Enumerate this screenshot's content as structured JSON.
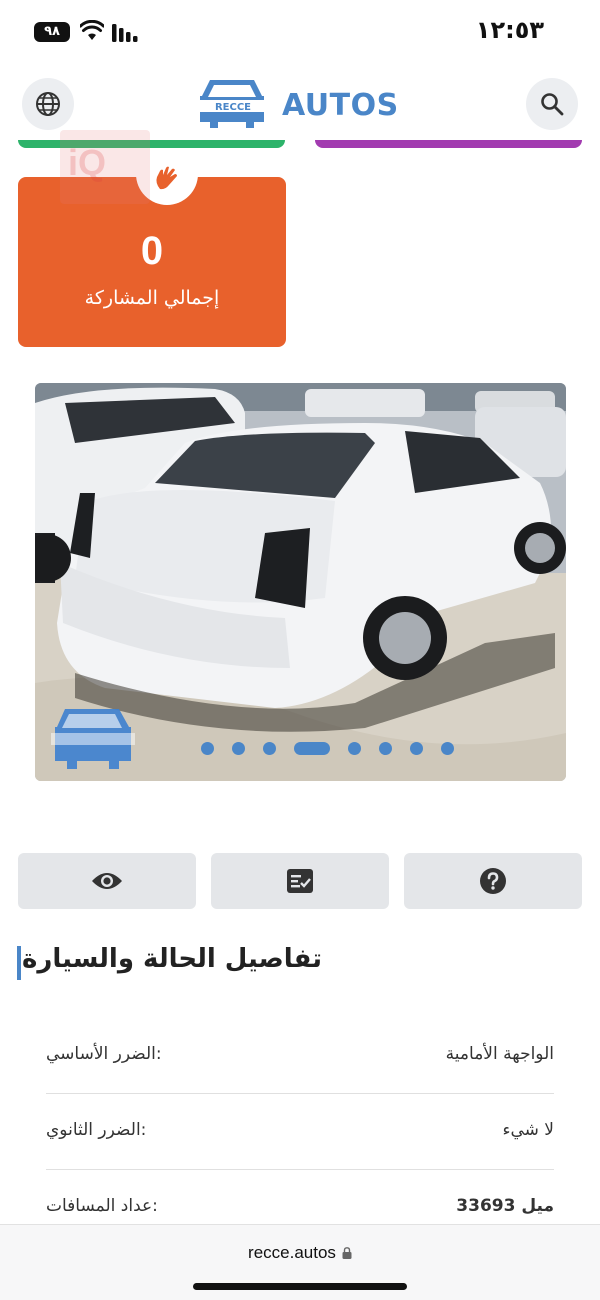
{
  "status_bar": {
    "time": "١٢:٥٣",
    "battery": "٩٨"
  },
  "header": {
    "logo_badge_text": "RECCE",
    "logo_text": "AUTOS"
  },
  "watermark_text": "iQ",
  "share_card": {
    "count": "0",
    "label": "إجمالي المشاركة"
  },
  "carousel": {
    "dots": 8,
    "active_index": 3
  },
  "section": {
    "title": "تفاصيل الحالة والسيارة"
  },
  "details": [
    {
      "label": ":الضرر الأساسي",
      "value": "الواجهة الأمامية"
    },
    {
      "label": ":الضرر الثانوي",
      "value": "لا شيء"
    },
    {
      "label": ":عداد المسافات",
      "value": "ميل 33693"
    }
  ],
  "browser": {
    "url": "recce.autos"
  },
  "colors": {
    "accent_blue": "#4a86c8",
    "orange": "#e8612c",
    "green": "#2db36a",
    "purple": "#a23bb0"
  }
}
